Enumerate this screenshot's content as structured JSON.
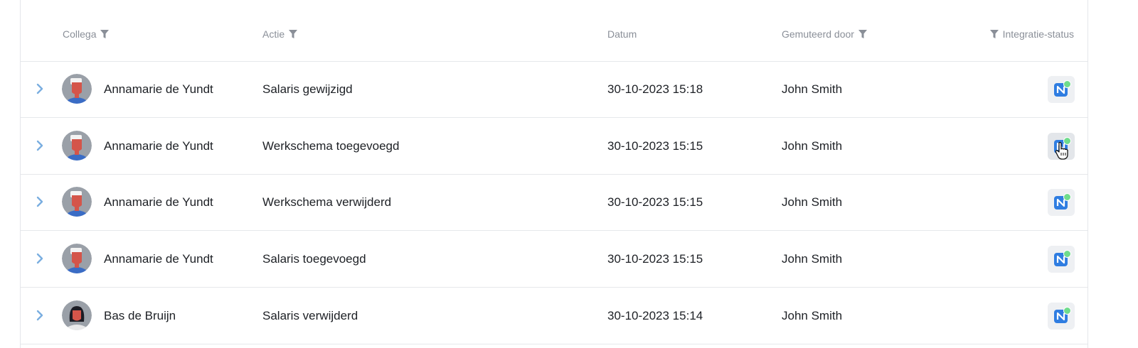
{
  "columns": {
    "collega": "Collega",
    "actie": "Actie",
    "datum": "Datum",
    "gemuteerd_door": "Gemuteerd door",
    "integratie_status": "Integratie-status"
  },
  "rows": [
    {
      "collega": "Annamarie de Yundt",
      "actie": "Salaris gewijzigd",
      "datum": "30-10-2023 15:18",
      "gemuteerd_door": "John Smith",
      "status": "connected"
    },
    {
      "collega": "Annamarie de Yundt",
      "actie": "Werkschema toegevoegd",
      "datum": "30-10-2023 15:15",
      "gemuteerd_door": "John Smith",
      "status": "connected"
    },
    {
      "collega": "Annamarie de Yundt",
      "actie": "Werkschema verwijderd",
      "datum": "30-10-2023 15:15",
      "gemuteerd_door": "John Smith",
      "status": "connected"
    },
    {
      "collega": "Annamarie de Yundt",
      "actie": "Salaris toegevoegd",
      "datum": "30-10-2023 15:15",
      "gemuteerd_door": "John Smith",
      "status": "connected"
    },
    {
      "collega": "Bas de Bruijn",
      "actie": "Salaris verwijderd",
      "datum": "30-10-2023 15:14",
      "gemuteerd_door": "John Smith",
      "status": "connected"
    }
  ],
  "colors": {
    "status_ok": "#6fdc8c",
    "integration_blue": "#2f7de1",
    "chevron": "#7aaee0"
  },
  "icons": {
    "filter": "filter-icon",
    "expand": "chevron-right-icon",
    "integration": "nmbrs-logo-icon",
    "status": "status-dot-icon",
    "pointer": "hand-pointer-cursor-icon"
  }
}
